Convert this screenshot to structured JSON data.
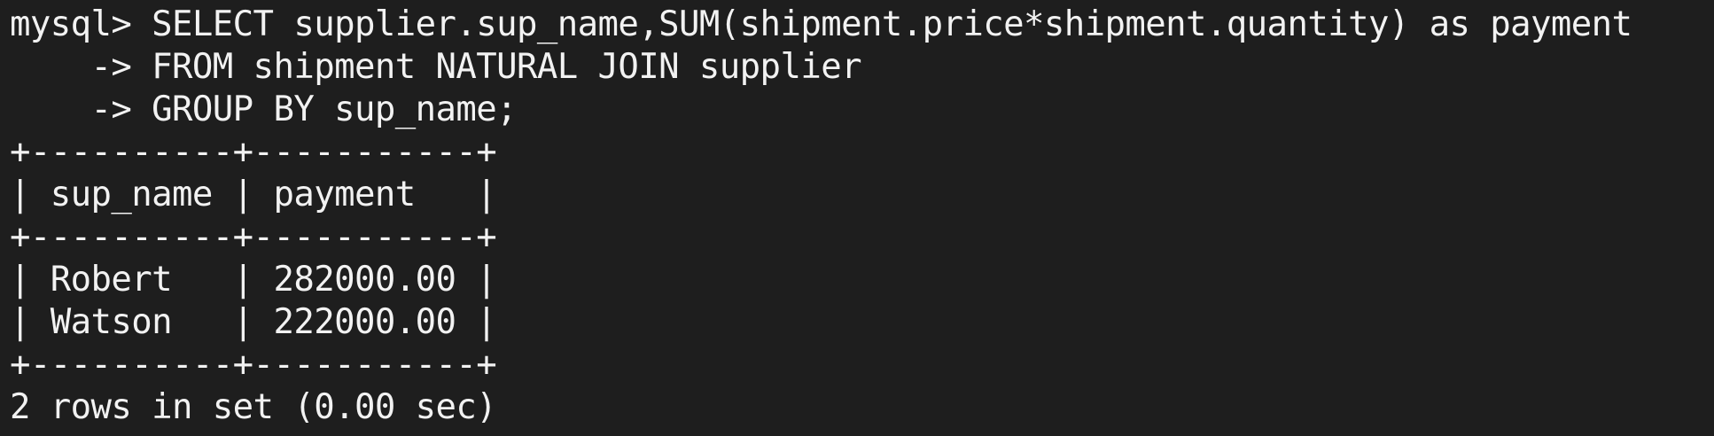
{
  "terminal": {
    "query": [
      "mysql> SELECT supplier.sup_name,SUM(shipment.price*shipment.quantity) as payment",
      "    -> FROM shipment NATURAL JOIN supplier",
      "    -> GROUP BY sup_name;"
    ],
    "table": {
      "top_border": "+----------+-----------+",
      "header_row": "| sup_name | payment   |",
      "header_border": "+----------+-----------+",
      "rows": [
        "| Robert   | 282000.00 |",
        "| Watson   | 222000.00 |"
      ],
      "bottom_border": "+----------+-----------+"
    },
    "status": "2 rows in set (0.00 sec)"
  }
}
